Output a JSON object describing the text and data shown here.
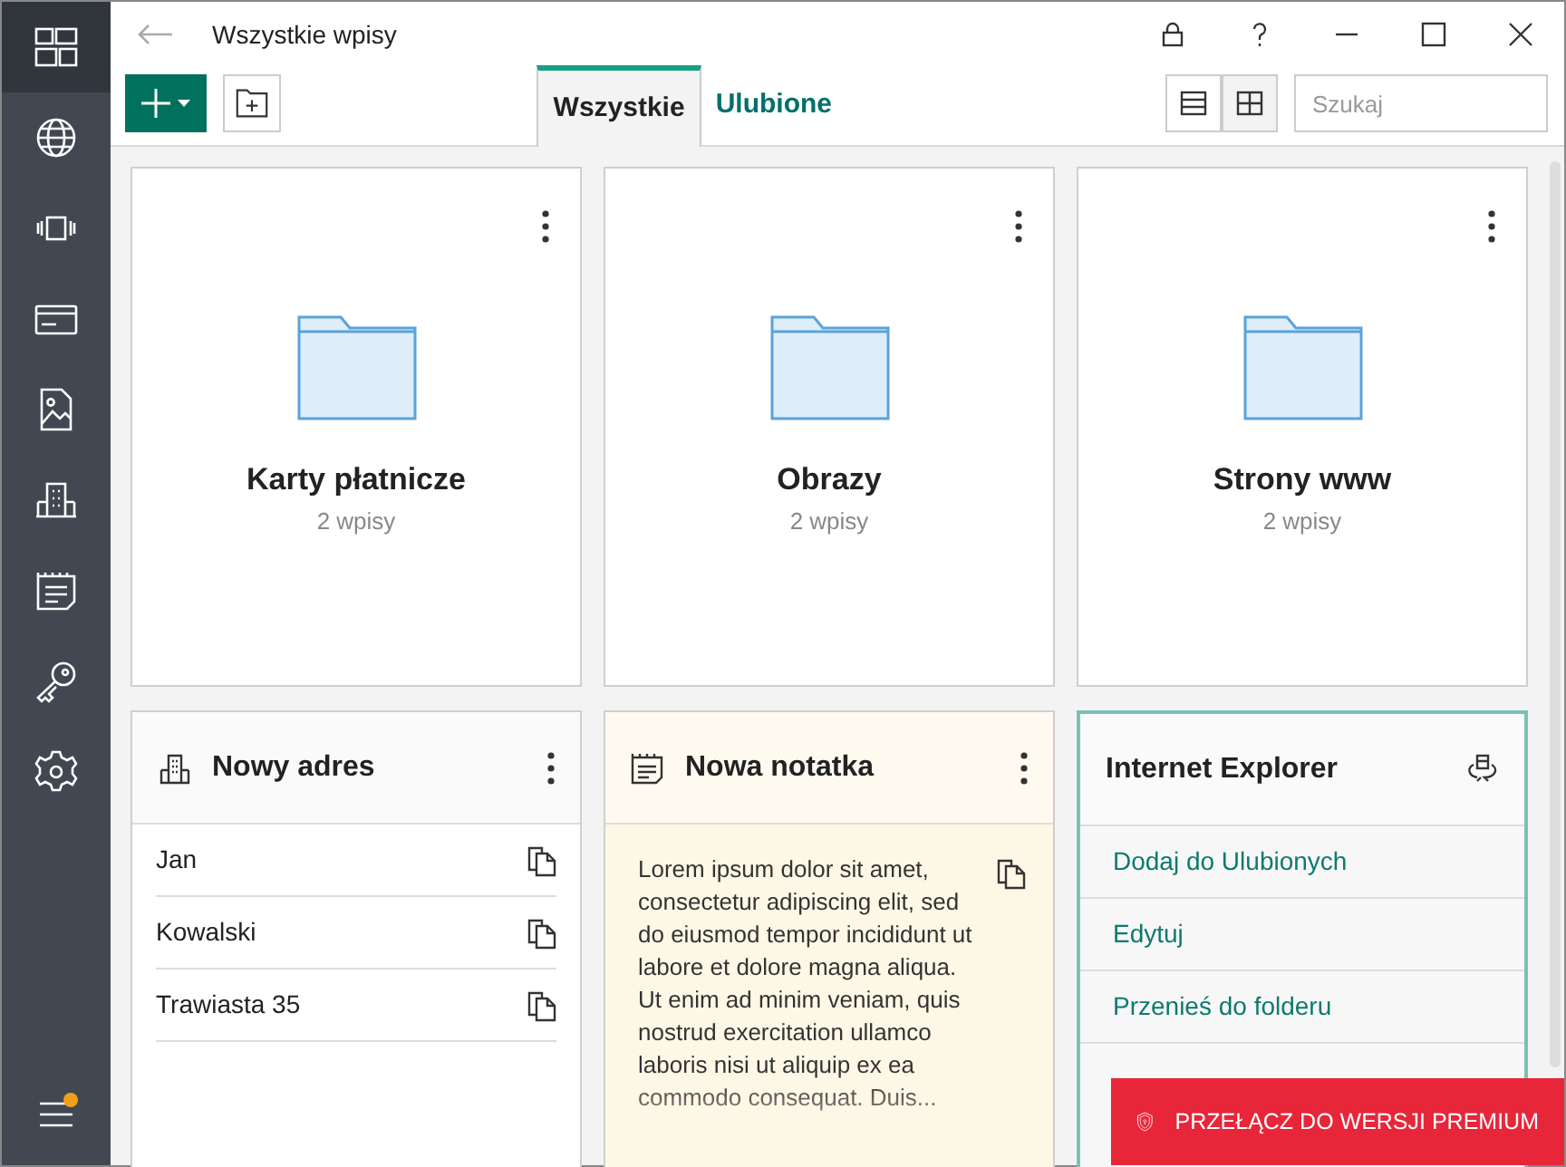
{
  "window": {
    "title": "Wszystkie wpisy"
  },
  "sidebar": {
    "items": [
      {
        "kind": "dashboard",
        "selected": true
      },
      {
        "kind": "globe",
        "selected": false
      },
      {
        "kind": "device",
        "selected": false
      },
      {
        "kind": "card",
        "selected": false
      },
      {
        "kind": "image",
        "selected": false
      },
      {
        "kind": "building",
        "selected": false
      },
      {
        "kind": "note",
        "selected": false
      },
      {
        "kind": "key",
        "selected": false
      },
      {
        "kind": "settings",
        "selected": false
      }
    ],
    "menu": {
      "badge": true
    }
  },
  "tabs": [
    {
      "label": "Wszystkie",
      "selected": true
    },
    {
      "label": "Ulubione",
      "selected": false
    }
  ],
  "view_modes": [
    {
      "kind": "list",
      "selected": false
    },
    {
      "kind": "grid",
      "selected": true
    }
  ],
  "search": {
    "placeholder": "Szukaj"
  },
  "folders": [
    {
      "title": "Karty płatnicze",
      "count": "2 wpisy"
    },
    {
      "title": "Obrazy",
      "count": "2 wpisy"
    },
    {
      "title": "Strony www",
      "count": "2 wpisy"
    }
  ],
  "cards": [
    {
      "kind": "address",
      "title": "Nowy adres",
      "selected": false,
      "fields": [
        "Jan",
        "Kowalski",
        "Trawiasta 35"
      ]
    },
    {
      "kind": "note",
      "title": "Nowa notatka",
      "selected": false,
      "text": "Lorem ipsum dolor sit amet, consectetur adipiscing elit, sed do eiusmod tempor incididunt ut labore et dolore magna aliqua. Ut enim ad minim veniam, quis nostrud exercitation ullamco laboris nisi ut aliquip ex ea commodo consequat. Duis..."
    },
    {
      "kind": "website",
      "title": "Internet Explorer",
      "selected": true,
      "actions": [
        "Dodaj do Ulubionych",
        "Edytuj",
        "Przenieś do folderu"
      ]
    }
  ],
  "premium_banner": {
    "label": "PRZEŁĄCZ DO WERSJI PREMIUM"
  }
}
